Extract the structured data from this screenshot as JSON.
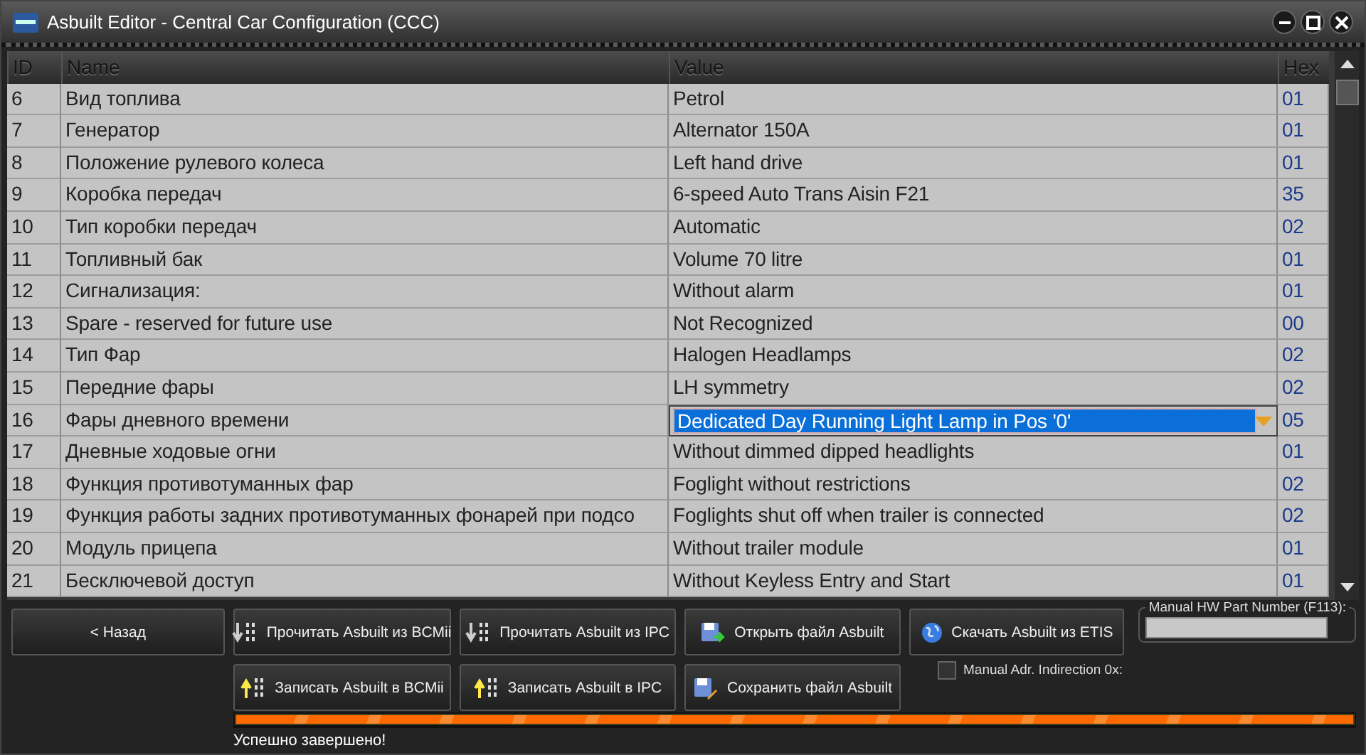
{
  "window": {
    "title": "Asbuilt Editor - Central Car Configuration (CCC)"
  },
  "table": {
    "columns": [
      "ID",
      "Name",
      "Value",
      "Hex"
    ],
    "rows": [
      {
        "id": "6",
        "name": "Вид топлива",
        "value": "Petrol",
        "hex": "01",
        "selected": false
      },
      {
        "id": "7",
        "name": "Генератор",
        "value": "Alternator 150A",
        "hex": "01",
        "selected": false
      },
      {
        "id": "8",
        "name": "Положение рулевого колеса",
        "value": "Left hand drive",
        "hex": "01",
        "selected": false
      },
      {
        "id": "9",
        "name": "Коробка передач",
        "value": "6-speed Auto Trans Aisin F21",
        "hex": "35",
        "selected": false
      },
      {
        "id": "10",
        "name": "Тип коробки передач",
        "value": "Automatic",
        "hex": "02",
        "selected": false
      },
      {
        "id": "11",
        "name": "Топливный бак",
        "value": "Volume 70 litre",
        "hex": "01",
        "selected": false
      },
      {
        "id": "12",
        "name": "Сигнализация:",
        "value": "Without alarm",
        "hex": "01",
        "selected": false
      },
      {
        "id": "13",
        "name": "Spare - reserved for future use",
        "value": "Not Recognized",
        "hex": "00",
        "selected": false
      },
      {
        "id": "14",
        "name": "Тип Фар",
        "value": "Halogen Headlamps",
        "hex": "02",
        "selected": false
      },
      {
        "id": "15",
        "name": "Передние фары",
        "value": "LH symmetry",
        "hex": "02",
        "selected": false
      },
      {
        "id": "16",
        "name": "Фары дневного времени",
        "value": "Dedicated Day Running Light Lamp in Pos '0'",
        "hex": "05",
        "selected": true
      },
      {
        "id": "17",
        "name": "Дневные ходовые огни",
        "value": "Without dimmed dipped headlights",
        "hex": "01",
        "selected": false
      },
      {
        "id": "18",
        "name": "Функция противотуманных фар",
        "value": "Foglight without restrictions",
        "hex": "02",
        "selected": false
      },
      {
        "id": "19",
        "name": "Функция работы задних противотуманных фонарей при подсо",
        "value": "Foglights shut off when trailer is connected",
        "hex": "02",
        "selected": false
      },
      {
        "id": "20",
        "name": "Модуль прицепа",
        "value": "Without trailer module",
        "hex": "01",
        "selected": false
      },
      {
        "id": "21",
        "name": "Бесключевой доступ",
        "value": "Without Keyless Entry and Start",
        "hex": "01",
        "selected": false
      }
    ]
  },
  "buttons": [
    {
      "label": "< Назад",
      "kind": "plain"
    },
    {
      "label": "Прочитать Asbuilt из BCMii",
      "kind": "read"
    },
    {
      "label": "Прочитать Asbuilt из IPC",
      "kind": "read"
    },
    {
      "label": "Открыть файл Asbuilt",
      "kind": "open"
    },
    {
      "label": "Скачать Asbuilt из ETIS",
      "kind": "download"
    },
    {
      "label": "Записать Asbuilt в BCMii",
      "kind": "write"
    },
    {
      "label": "Записать Asbuilt в IPC",
      "kind": "write"
    },
    {
      "label": "Сохранить файл Asbuilt",
      "kind": "save"
    }
  ],
  "part_number": {
    "label": "Manual HW Part Number (F113):"
  },
  "indirection": {
    "label": "Manual Adr. Indirection 0x:",
    "checked": false
  },
  "progress": {
    "level": 1
  },
  "status_bar": {
    "text": "Успешно завершено!"
  }
}
